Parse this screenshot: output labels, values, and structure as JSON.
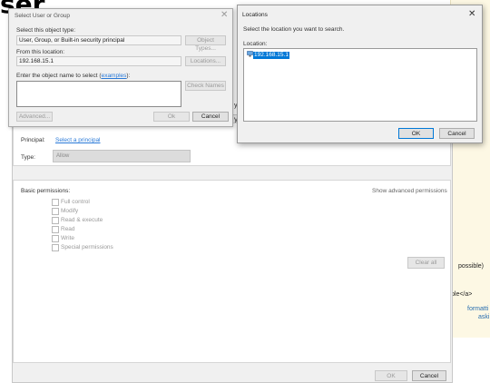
{
  "background": {
    "title_fragment": "ser",
    "side_texts": [
      "possible)",
      "ple</a>",
      "formatti",
      "aski"
    ],
    "peek_chars": [
      "y",
      "y"
    ]
  },
  "permission_dialog": {
    "principal_label": "Principal:",
    "principal_link": "Select a principal",
    "type_label": "Type:",
    "type_value": "Allow",
    "basic_permissions_label": "Basic permissions:",
    "show_advanced": "Show advanced permissions",
    "permissions": [
      "Full control",
      "Modify",
      "Read & execute",
      "Read",
      "Write",
      "Special permissions"
    ],
    "clear_all": "Clear all",
    "ok": "OK",
    "cancel": "Cancel"
  },
  "select_dialog": {
    "title": "Select User or Group",
    "object_type_label": "Select this object type:",
    "object_type_value": "User, Group, or Built-in security principal",
    "object_types_button": "Object Types...",
    "location_label": "From this location:",
    "location_value": "192.168.15.1",
    "locations_button": "Locations...",
    "enter_name_prefix": "Enter the object name to select (",
    "examples_link": "examples",
    "enter_name_suffix": "):",
    "check_names_button": "Check Names",
    "advanced_button": "Advanced...",
    "ok": "Ok",
    "cancel": "Cancel"
  },
  "locations_dialog": {
    "title": "Locations",
    "instruction": "Select the location you want to search.",
    "location_label": "Location:",
    "tree_item": "192.168.15.1",
    "ok": "OK",
    "cancel": "Cancel"
  },
  "icons": [
    "close-icon",
    "computer-icon",
    "checkbox-icon"
  ]
}
